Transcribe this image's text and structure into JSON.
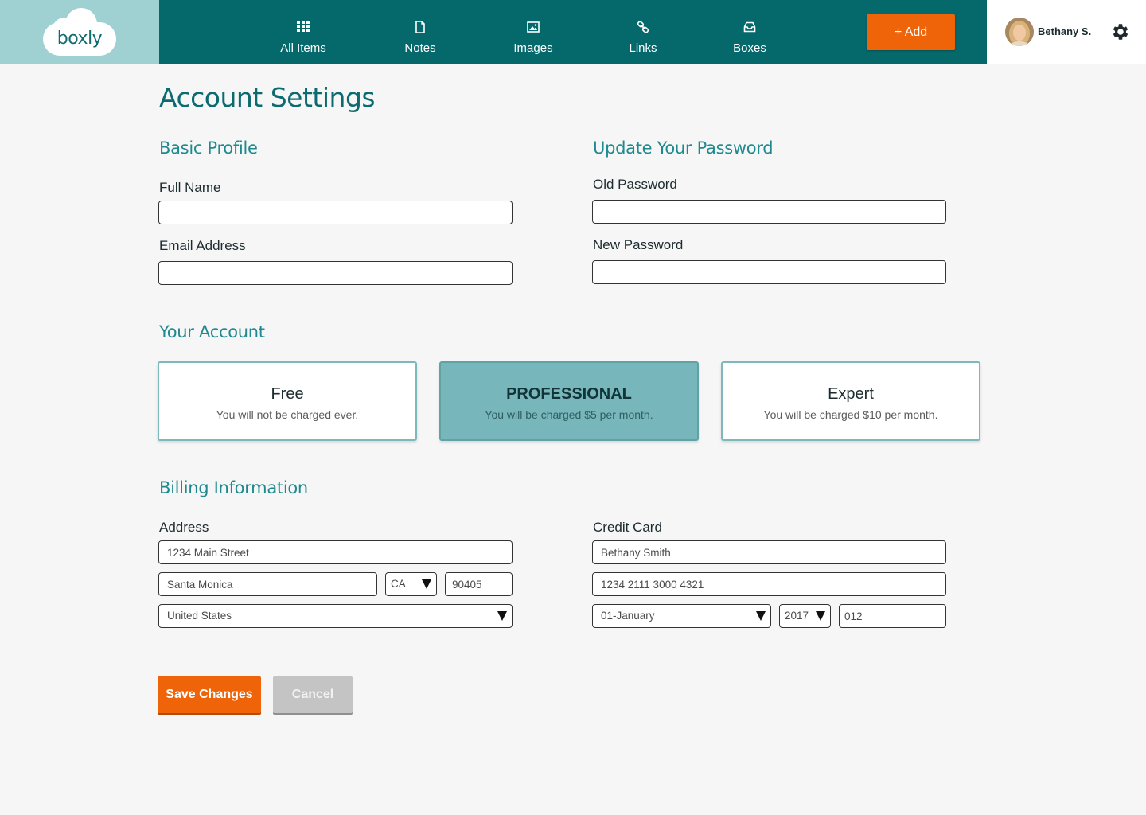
{
  "brand": {
    "logo_text": "boxly",
    "header_color": "#05696c",
    "logo_bg": "#9fd1d3",
    "accent": "#ef6409"
  },
  "nav": {
    "items": [
      {
        "label": "All Items",
        "icon": "grid-icon"
      },
      {
        "label": "Notes",
        "icon": "document-icon"
      },
      {
        "label": "Images",
        "icon": "image-icon"
      },
      {
        "label": "Links",
        "icon": "link-icon"
      },
      {
        "label": "Boxes",
        "icon": "inbox-icon"
      }
    ],
    "add_label": "+ Add"
  },
  "user": {
    "name": "Bethany S.",
    "settings_icon": "gear-icon"
  },
  "page": {
    "title": "Account Settings"
  },
  "basic_profile": {
    "title": "Basic Profile",
    "full_name_label": "Full Name",
    "full_name_value": "",
    "email_label": "Email Address",
    "email_value": ""
  },
  "password": {
    "title": "Update Your Password",
    "old_label": "Old Password",
    "new_label": "New Password"
  },
  "account": {
    "title": "Your Account",
    "plans": [
      {
        "name": "Free",
        "description": "You will not be charged ever.",
        "selected": false
      },
      {
        "name": "PROFESSIONAL",
        "description": "You will be charged $5 per month.",
        "selected": true
      },
      {
        "name": "Expert",
        "description": "You will be charged $10 per month.",
        "selected": false
      }
    ]
  },
  "billing": {
    "title": "Billing Information",
    "address_label": "Address",
    "street": "1234 Main Street",
    "city": "Santa Monica",
    "state": "CA",
    "zip": "90405",
    "country": "United States",
    "card_label": "Credit Card",
    "card_name": "Bethany Smith",
    "card_number": "1234 2111 3000 4321",
    "exp_month": "01-January",
    "exp_year": "2017",
    "cvv": "012"
  },
  "actions": {
    "save_label": "Save Changes",
    "cancel_label": "Cancel"
  }
}
